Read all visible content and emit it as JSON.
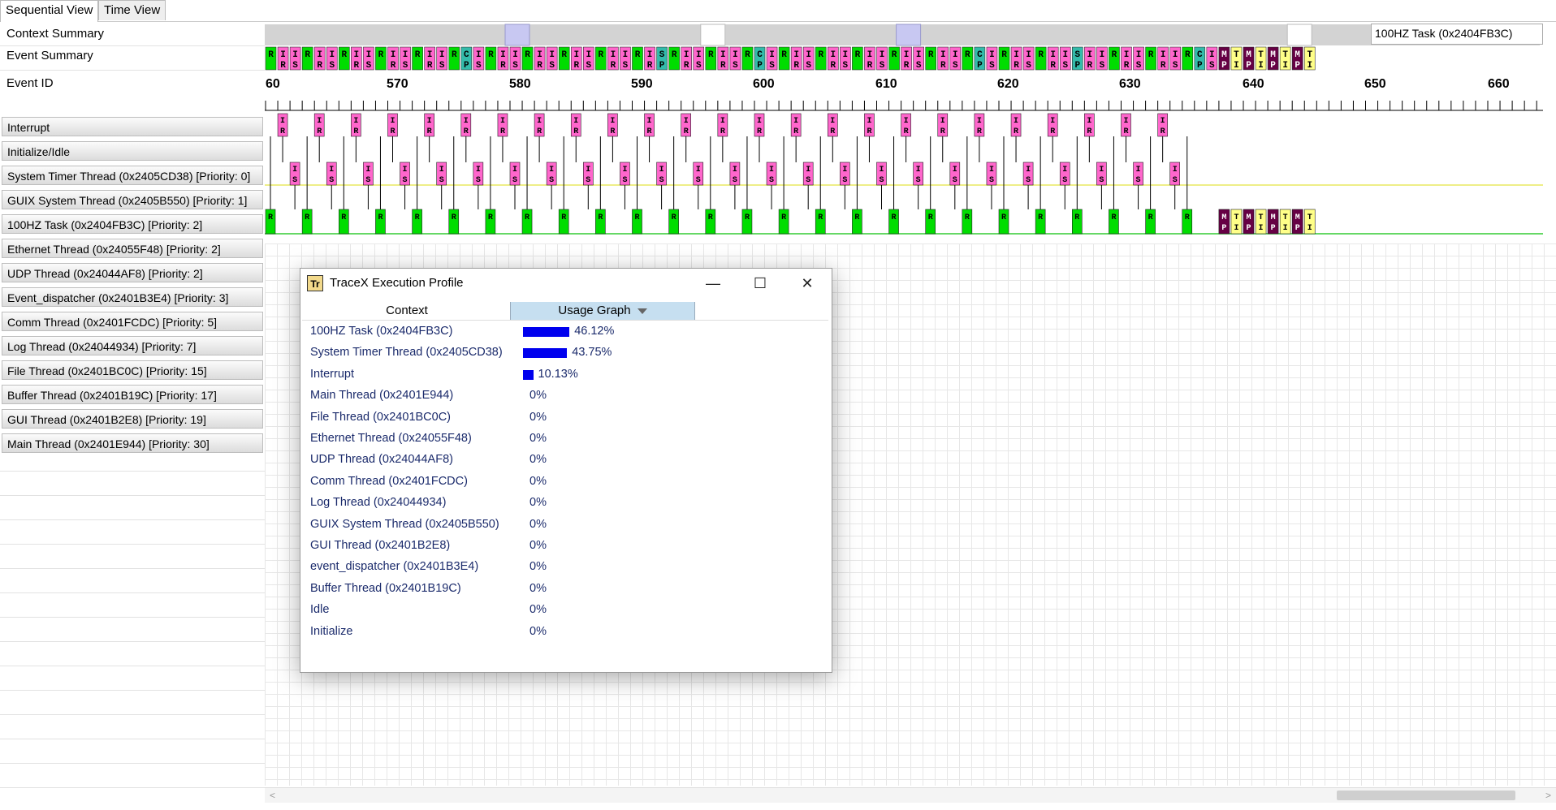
{
  "tabs": [
    {
      "label": "Sequential View",
      "active": true
    },
    {
      "label": "Time View",
      "active": false
    }
  ],
  "rows": {
    "context_summary": "Context Summary",
    "event_summary": "Event Summary",
    "event_id": "Event ID"
  },
  "tooltip": "100HZ Task (0x2404FB3C)",
  "threads": [
    "Interrupt",
    "Initialize/Idle",
    "System Timer Thread (0x2405CD38) [Priority: 0]",
    "GUIX System Thread (0x2405B550) [Priority: 1]",
    "100HZ Task (0x2404FB3C) [Priority: 2]",
    "Ethernet Thread (0x24055F48) [Priority: 2]",
    "UDP Thread (0x24044AF8) [Priority: 2]",
    "Event_dispatcher (0x2401B3E4) [Priority: 3]",
    "Comm Thread (0x2401FCDC) [Priority: 5]",
    "Log Thread (0x24044934) [Priority: 7]",
    "File Thread (0x2401BC0C) [Priority: 15]",
    "Buffer Thread (0x2401B19C) [Priority: 17]",
    "GUI Thread (0x2401B2E8) [Priority: 19]",
    "Main Thread (0x2401E944) [Priority: 30]"
  ],
  "event_ticks": [
    "60",
    "570",
    "580",
    "590",
    "600",
    "610",
    "620",
    "630",
    "640",
    "650",
    "660"
  ],
  "colors": {
    "interrupt": "#ff66cc",
    "thread": "#00dd00",
    "context_switch": "#33bbaa",
    "accent_bar": "#0000ee",
    "header_highlight": "#c6dff0",
    "event_purple": "#660044",
    "event_yellow": "#ffff88"
  },
  "dialog": {
    "title": "TraceX Execution Profile",
    "icon": "Tr",
    "col_context": "Context",
    "col_usage": "Usage Graph",
    "rows": [
      {
        "name": "100HZ Task (0x2404FB3C)",
        "pct_label": "46.12%",
        "value": 46.12
      },
      {
        "name": "System Timer Thread (0x2405CD38)",
        "pct_label": "43.75%",
        "value": 43.75
      },
      {
        "name": "Interrupt",
        "pct_label": "10.13%",
        "value": 10.13
      },
      {
        "name": "Main Thread (0x2401E944)",
        "pct_label": "0%",
        "value": 0
      },
      {
        "name": "File Thread (0x2401BC0C)",
        "pct_label": "0%",
        "value": 0
      },
      {
        "name": "Ethernet Thread (0x24055F48)",
        "pct_label": "0%",
        "value": 0
      },
      {
        "name": "UDP Thread (0x24044AF8)",
        "pct_label": "0%",
        "value": 0
      },
      {
        "name": "Comm Thread (0x2401FCDC)",
        "pct_label": "0%",
        "value": 0
      },
      {
        "name": "Log Thread (0x24044934)",
        "pct_label": "0%",
        "value": 0
      },
      {
        "name": "GUIX System Thread (0x2405B550)",
        "pct_label": "0%",
        "value": 0
      },
      {
        "name": "GUI Thread (0x2401B2E8)",
        "pct_label": "0%",
        "value": 0
      },
      {
        "name": "event_dispatcher (0x2401B3E4)",
        "pct_label": "0%",
        "value": 0
      },
      {
        "name": "Buffer Thread (0x2401B19C)",
        "pct_label": "0%",
        "value": 0
      },
      {
        "name": "Idle",
        "pct_label": "0%",
        "value": 0
      },
      {
        "name": "Initialize",
        "pct_label": "0%",
        "value": 0
      }
    ]
  },
  "window_controls": {
    "minimize": "—",
    "maximize": "☐",
    "close": "✕"
  }
}
